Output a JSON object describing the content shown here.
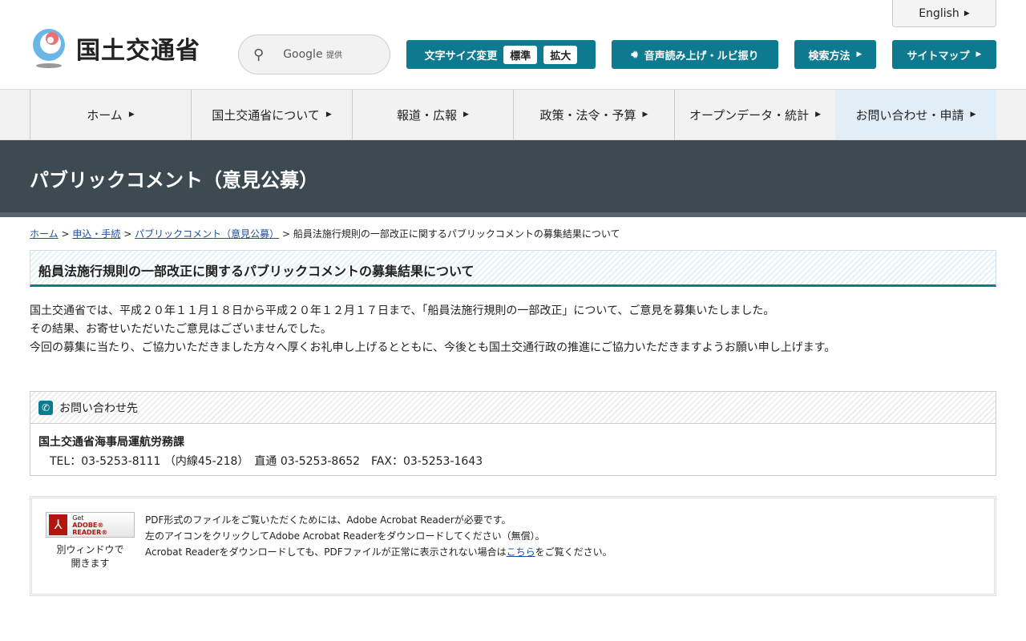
{
  "header": {
    "english": "English",
    "logo_text": "国土交通省",
    "search_label": "Google",
    "search_sub": "提供",
    "font_size_label": "文字サイズ変更",
    "font_standard": "標準",
    "font_large": "拡大",
    "speech": "音声読み上げ・ルビ振り",
    "search_method": "検索方法",
    "sitemap": "サイトマップ"
  },
  "nav": [
    "ホーム",
    "国土交通省について",
    "報道・広報",
    "政策・法令・予算",
    "オープンデータ・統計",
    "お問い合わせ・申請"
  ],
  "banner": "パブリックコメント（意見公募）",
  "breadcrumb": {
    "items": [
      "ホーム",
      "申込・手続",
      "パブリックコメント（意見公募）"
    ],
    "current": "船員法施行規則の一部改正に関するパブリックコメントの募集結果について",
    "sep": ">"
  },
  "title": "船員法施行規則の一部改正に関するパブリックコメントの募集結果について",
  "body": [
    "国土交通省では、平成２０年１１月１８日から平成２０年１２月１７日まで、「船員法施行規則の一部改正」について、ご意見を募集いたしました。",
    "その結果、お寄せいただいたご意見はございませんでした。",
    "今回の募集に当たり、ご協力いただきました方々へ厚くお礼申し上げるとともに、今後とも国土交通行政の推進にご協力いただきますようお願い申し上げます。"
  ],
  "contact": {
    "heading": "お問い合わせ先",
    "org": "国土交通省海事局運航労務課",
    "tel": "TEL：03-5253-8111 （内線45-218）　直通 03-5253-8652　FAX：03-5253-1643"
  },
  "pdf": {
    "badge_get": "Get",
    "badge_name": "ADOBE® READER®",
    "caption1": "別ウィンドウで",
    "caption2": "開きます",
    "line1": "PDF形式のファイルをご覧いただくためには、Adobe Acrobat Readerが必要です。",
    "line2": "左のアイコンをクリックしてAdobe Acrobat Readerをダウンロードしてください（無償）。",
    "line3a": "Acrobat Readerをダウンロードしても、PDFファイルが正常に表示されない場合は",
    "line3link": "こちら",
    "line3b": "をご覧ください。"
  }
}
